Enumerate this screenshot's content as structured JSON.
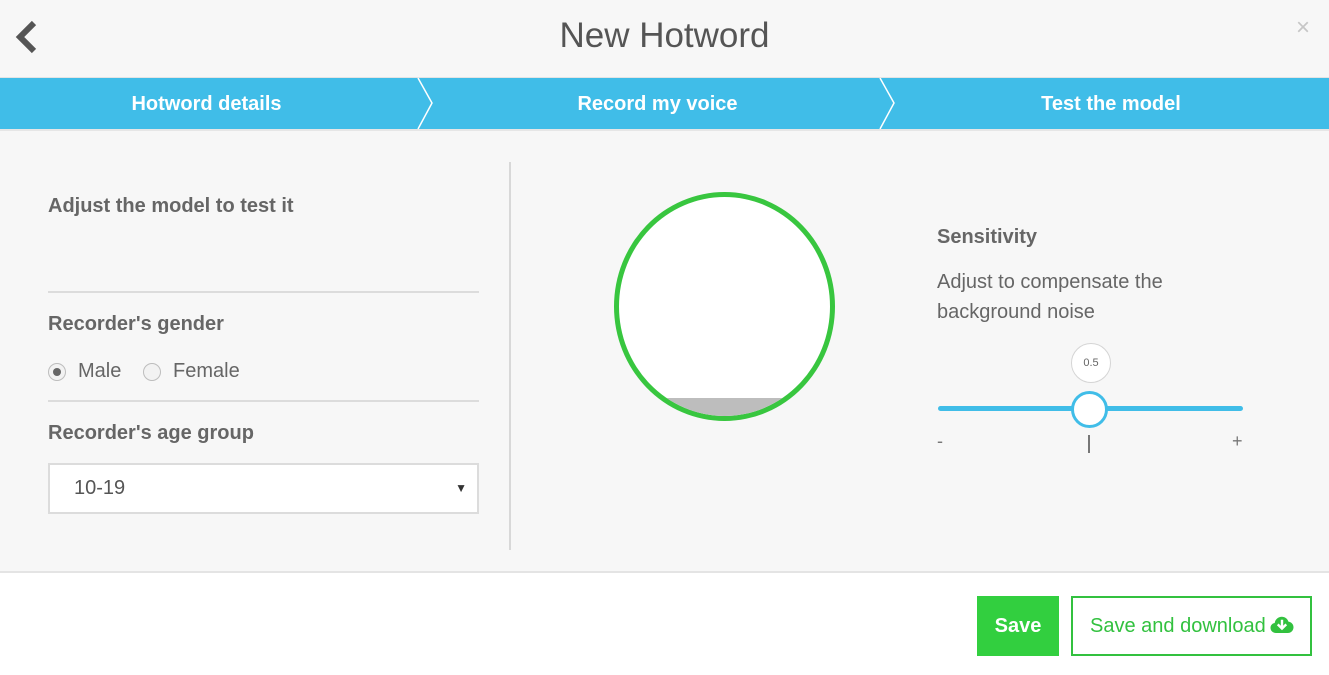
{
  "header": {
    "title": "New Hotword",
    "back_icon": "chevron-left-icon",
    "close_label": "×"
  },
  "steps": [
    {
      "label": "Hotword details"
    },
    {
      "label": "Record my voice"
    },
    {
      "label": "Test the model"
    }
  ],
  "left_panel": {
    "heading": "Adjust the model to test it",
    "gender": {
      "label": "Recorder's gender",
      "options": [
        {
          "label": "Male",
          "checked": true
        },
        {
          "label": "Female",
          "checked": false
        }
      ]
    },
    "age": {
      "label": "Recorder's age group",
      "selected": "10-19",
      "caret": "▼"
    }
  },
  "recorder": {
    "ring_color": "#38c63f",
    "level": 0.08
  },
  "sensitivity": {
    "title": "Sensitivity",
    "description": "Adjust to compensate the background noise",
    "value": "0.5",
    "min_label": "-",
    "max_label": "+"
  },
  "footer": {
    "save_label": "Save",
    "save_download_label": "Save and download",
    "download_icon": "cloud-download-icon"
  },
  "colors": {
    "accent_blue": "#40bde8",
    "accent_green": "#32cf3f",
    "background": "#f7f7f7"
  }
}
